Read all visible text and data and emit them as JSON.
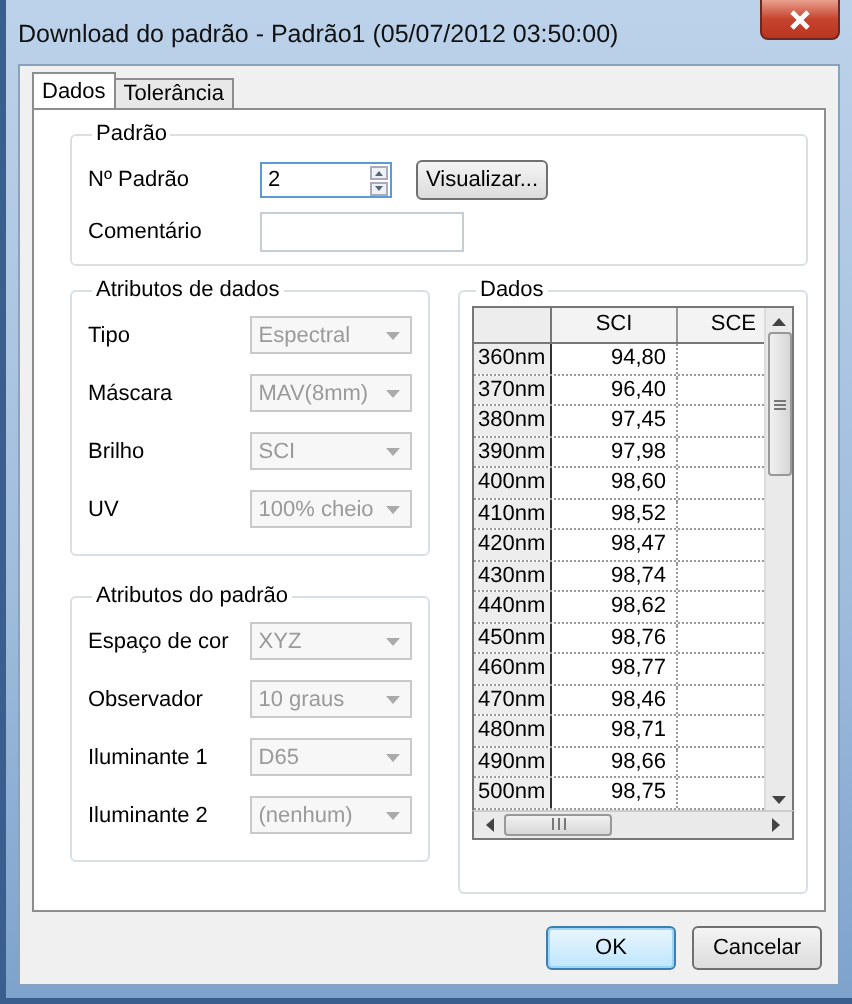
{
  "window": {
    "title": "Download do padrão - Padrão1 (05/07/2012 03:50:00)"
  },
  "tabs": [
    {
      "label": "Dados",
      "selected": true
    },
    {
      "label": "Tolerância",
      "selected": false
    }
  ],
  "standard_group": {
    "title": "Padrão",
    "number_label": "Nº Padrão",
    "number_value": "2",
    "view_button": "Visualizar...",
    "comment_label": "Comentário"
  },
  "data_attributes": {
    "title": "Atributos de dados",
    "fields": [
      {
        "label": "Tipo",
        "value": "Espectral",
        "disabled": true
      },
      {
        "label": "Máscara",
        "value": "MAV(8mm)",
        "disabled": true
      },
      {
        "label": "Brilho",
        "value": "SCI",
        "disabled": true
      },
      {
        "label": "UV",
        "value": "100% cheio",
        "disabled": true
      }
    ]
  },
  "standard_attributes": {
    "title": "Atributos do padrão",
    "fields": [
      {
        "label": "Espaço de cor",
        "value": "XYZ",
        "disabled": true
      },
      {
        "label": "Observador",
        "value": "10 graus",
        "disabled": true
      },
      {
        "label": "Iluminante 1",
        "value": "D65",
        "disabled": true
      },
      {
        "label": "Iluminante 2",
        "value": "(nenhum)",
        "disabled": true
      }
    ]
  },
  "data_table": {
    "title": "Dados",
    "columns": [
      "SCI",
      "SCE"
    ],
    "rows": [
      {
        "label": "360nm",
        "values": [
          "94,80"
        ]
      },
      {
        "label": "370nm",
        "values": [
          "96,40"
        ]
      },
      {
        "label": "380nm",
        "values": [
          "97,45"
        ]
      },
      {
        "label": "390nm",
        "values": [
          "97,98"
        ]
      },
      {
        "label": "400nm",
        "values": [
          "98,60"
        ]
      },
      {
        "label": "410nm",
        "values": [
          "98,52"
        ]
      },
      {
        "label": "420nm",
        "values": [
          "98,47"
        ]
      },
      {
        "label": "430nm",
        "values": [
          "98,74"
        ]
      },
      {
        "label": "440nm",
        "values": [
          "98,62"
        ]
      },
      {
        "label": "450nm",
        "values": [
          "98,76"
        ]
      },
      {
        "label": "460nm",
        "values": [
          "98,77"
        ]
      },
      {
        "label": "470nm",
        "values": [
          "98,46"
        ]
      },
      {
        "label": "480nm",
        "values": [
          "98,71"
        ]
      },
      {
        "label": "490nm",
        "values": [
          "98,66"
        ]
      },
      {
        "label": "500nm",
        "values": [
          "98,75"
        ]
      }
    ]
  },
  "buttons": [
    {
      "label": "OK",
      "default": true
    },
    {
      "label": "Cancelar",
      "default": false
    }
  ]
}
